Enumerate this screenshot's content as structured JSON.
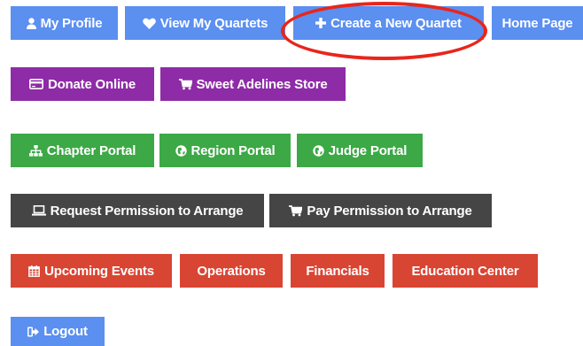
{
  "colors": {
    "blue": "#5b8ff0",
    "purple": "#8e2ba6",
    "green": "#3da846",
    "dark": "#454545",
    "red": "#d94533",
    "highlight_oval": "#e8261c"
  },
  "row1": {
    "my_profile": "My Profile",
    "view_quartets": "View My Quartets",
    "create_quartet": "Create a New Quartet",
    "home_page": "Home Page"
  },
  "row2": {
    "donate_online": "Donate Online",
    "store": "Sweet Adelines Store"
  },
  "row3": {
    "chapter_portal": "Chapter Portal",
    "region_portal": "Region Portal",
    "judge_portal": "Judge Portal"
  },
  "row4": {
    "request_permission": "Request Permission to Arrange",
    "pay_permission": "Pay Permission to Arrange"
  },
  "row5": {
    "upcoming_events": "Upcoming Events",
    "operations": "Operations",
    "financials": "Financials",
    "education_center": "Education Center"
  },
  "row6": {
    "logout": "Logout"
  },
  "icons": {
    "my_profile": "user-icon",
    "view_quartets": "heart-icon",
    "create_quartet": "plus-icon",
    "donate_online": "credit-card-icon",
    "store": "shopping-cart-icon",
    "chapter_portal": "sitemap-icon",
    "region_portal": "globe-icon",
    "judge_portal": "globe-icon",
    "request_permission": "laptop-icon",
    "pay_permission": "shopping-cart-icon",
    "upcoming_events": "calendar-icon",
    "logout": "sign-out-icon"
  }
}
